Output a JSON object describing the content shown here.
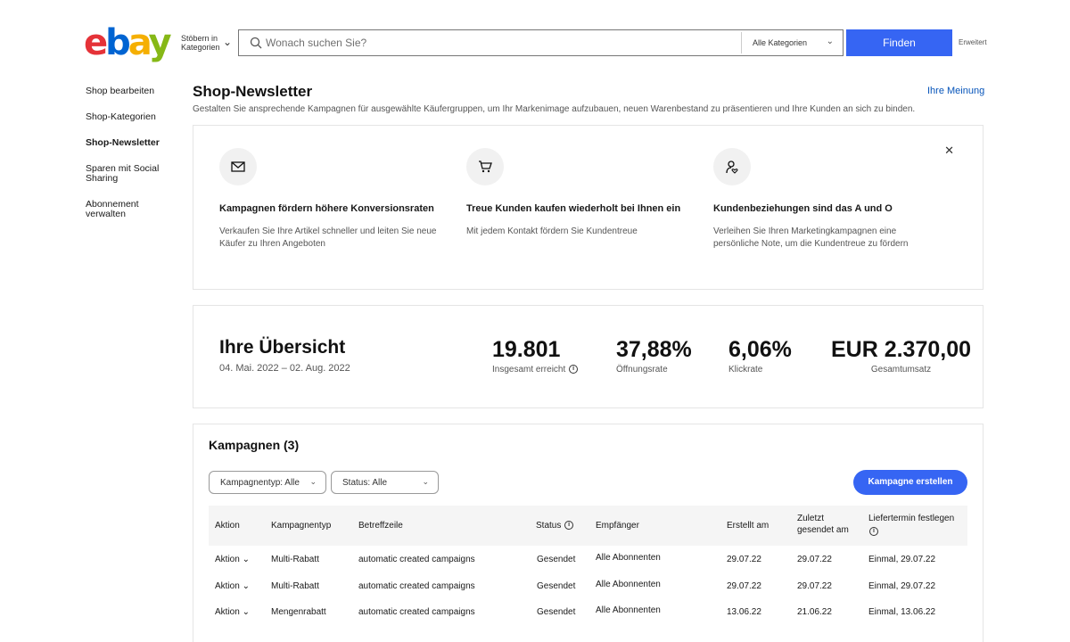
{
  "header": {
    "logo": {
      "e": "e",
      "b": "b",
      "a": "a",
      "y": "y"
    },
    "browse_label": "Stöbern in Kategorien",
    "search_placeholder": "Wonach suchen Sie?",
    "category_select": "Alle Kategorien",
    "find_button": "Finden",
    "advanced_link": "Erweitert"
  },
  "sidebar": {
    "items": [
      {
        "label": "Shop bearbeiten"
      },
      {
        "label": "Shop-Kategorien"
      },
      {
        "label": "Shop-Newsletter"
      },
      {
        "label": "Sparen mit Social Sharing"
      },
      {
        "label": "Abonnement verwalten"
      }
    ]
  },
  "main": {
    "title": "Shop-Newsletter",
    "feedback_link": "Ihre Meinung",
    "subtitle": "Gestalten Sie ansprechende Kampagnen für ausgewählte Käufergruppen, um Ihr Markenimage aufzubauen, neuen Warenbestand zu präsentieren und Ihre Kunden an sich zu binden."
  },
  "benefits": [
    {
      "icon": "mail-icon",
      "title": "Kampagnen fördern höhere Konversionsraten",
      "desc": "Verkaufen Sie Ihre Artikel schneller und leiten Sie neue Käufer zu Ihren Angeboten"
    },
    {
      "icon": "cart-icon",
      "title": "Treue Kunden kaufen wiederholt bei Ihnen ein",
      "desc": "Mit jedem Kontakt fördern Sie Kundentreue"
    },
    {
      "icon": "customer-heart-icon",
      "title": "Kundenbeziehungen sind das A und O",
      "desc": "Verleihen Sie Ihren Marketingkampagnen eine persönliche Note, um die Kundentreue zu fördern"
    }
  ],
  "overview": {
    "title": "Ihre Übersicht",
    "date_range": "04. Mai. 2022 – 02. Aug. 2022",
    "metrics": [
      {
        "value": "19.801",
        "label": "Insgesamt erreicht"
      },
      {
        "value": "37,88%",
        "label": "Öffnungsrate"
      },
      {
        "value": "6,06%",
        "label": "Klickrate"
      },
      {
        "value": "EUR 2.370,00",
        "label": "Gesamtumsatz"
      }
    ]
  },
  "campaigns": {
    "title": "Kampagnen (3)",
    "filter_type": "Kampagnentyp: Alle",
    "filter_status": "Status: Alle",
    "create_button": "Kampagne erstellen",
    "columns": {
      "action": "Aktion",
      "type": "Kampagnentyp",
      "subject": "Betreffzeile",
      "status": "Status",
      "recipients": "Empfänger",
      "created": "Erstellt am",
      "last_sent_1": "Zuletzt",
      "last_sent_2": "gesendet am",
      "delivery_1": "Liefertermin festlegen"
    },
    "rows": [
      {
        "action": "Aktion",
        "type": "Multi-Rabatt",
        "subject": "automatic created campaigns",
        "status": "Gesendet",
        "recipients": "Alle Abonnenten",
        "created": "29.07.22",
        "last_sent": "29.07.22",
        "delivery": "Einmal, 29.07.22"
      },
      {
        "action": "Aktion",
        "type": "Multi-Rabatt",
        "subject": "automatic created campaigns",
        "status": "Gesendet",
        "recipients": "Alle Abonnenten",
        "created": "29.07.22",
        "last_sent": "29.07.22",
        "delivery": "Einmal, 29.07.22"
      },
      {
        "action": "Aktion",
        "type": "Mengenrabatt",
        "subject": "automatic created campaigns",
        "status": "Gesendet",
        "recipients": "Alle Abonnenten",
        "created": "13.06.22",
        "last_sent": "21.06.22",
        "delivery": "Einmal, 13.06.22"
      }
    ]
  },
  "colors": {
    "primary_button": "#3665f3",
    "link": "#0654ba"
  }
}
